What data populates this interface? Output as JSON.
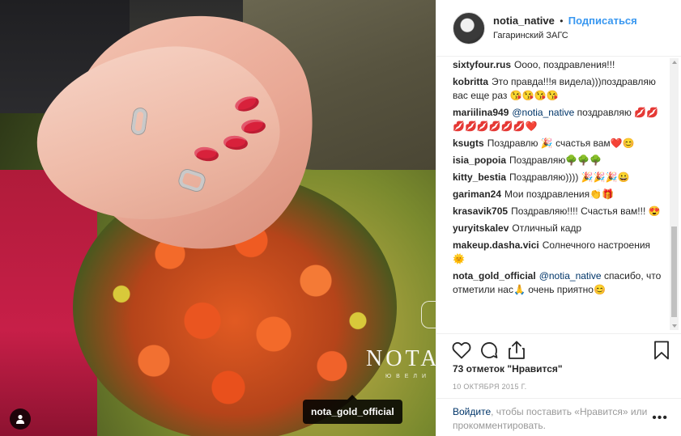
{
  "post": {
    "username": "notia_native",
    "follow_label": "Подписаться",
    "separator": "•",
    "location": "Гагаринский ЗАГС"
  },
  "photo": {
    "brand_text": "NOTA",
    "brand_sub": "ЮВЕЛИ",
    "tag_label": "nota_gold_official"
  },
  "comments": [
    {
      "user": "sixtyfour.rus",
      "text": "Оооо, поздравления!!!"
    },
    {
      "user": "kobritta",
      "text": "Это правда!!!я видела)))поздравляю вас еще раз 😘😘😘😘"
    },
    {
      "user": "mariilina949",
      "mention": "@notia_native",
      "text": "поздравляю 💋💋💋💋💋💋💋💋❤️"
    },
    {
      "user": "ksugts",
      "text": "Поздравлю 🎉 счастья вам❤️😊"
    },
    {
      "user": "isia_popoia",
      "text": "Поздравляю🌳🌳🌳"
    },
    {
      "user": "kitty_bestia",
      "text": "Поздравляю)))) 🎉🎉🎉😀"
    },
    {
      "user": "gariman24",
      "text": "Мои поздравления👏🎁"
    },
    {
      "user": "krasavik705",
      "text": "Поздравляю!!!! Счастья вам!!! 😍"
    },
    {
      "user": "yuryitskalev",
      "text": "Отличный кадр"
    },
    {
      "user": "makeup.dasha.vici",
      "text": "Солнечного настроения🌞"
    },
    {
      "user": "nota_gold_official",
      "mention": "@notia_native",
      "text": "спасибо, что отметили нас🙏 очень приятно😊"
    }
  ],
  "likes": {
    "count": "73 отметок",
    "text": "\"Нравится\""
  },
  "date": "10 ОКТЯБРЯ 2015 Г.",
  "login": {
    "link_login": "Войдите",
    "text": ", чтобы поставить «Нравится» или прокомментировать.",
    "more": "•••"
  },
  "icons": {
    "like": "heart-icon",
    "comment": "comment-icon",
    "share": "share-icon",
    "save": "bookmark-icon",
    "user_tag": "user-icon"
  },
  "colors": {
    "link_blue": "#3897f0",
    "mention": "#003569",
    "muted": "#999999",
    "nail_red": "#d8213b"
  }
}
